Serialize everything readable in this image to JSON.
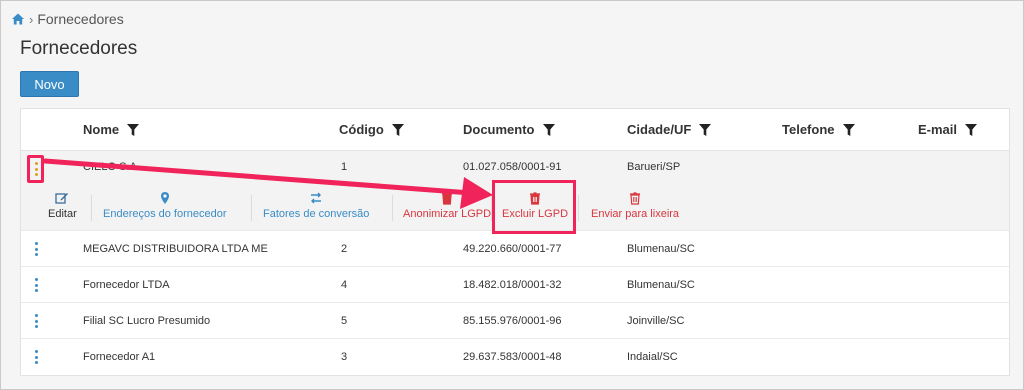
{
  "breadcrumb": {
    "current": "Fornecedores"
  },
  "page": {
    "title": "Fornecedores"
  },
  "toolbar": {
    "new_label": "Novo"
  },
  "table": {
    "columns": [
      "Nome",
      "Código",
      "Documento",
      "Cidade/UF",
      "Telefone",
      "E-mail"
    ],
    "rows": [
      {
        "nome": "CIELO S.A",
        "codigo": "1",
        "documento": "01.027.058/0001-91",
        "cidade": "Barueri/SP",
        "telefone": "",
        "email": ""
      },
      {
        "nome": "MEGAVC DISTRIBUIDORA LTDA ME",
        "codigo": "2",
        "documento": "49.220.660/0001-77",
        "cidade": "Blumenau/SC",
        "telefone": "",
        "email": ""
      },
      {
        "nome": "Fornecedor LTDA",
        "codigo": "4",
        "documento": "18.482.018/0001-32",
        "cidade": "Blumenau/SC",
        "telefone": "",
        "email": ""
      },
      {
        "nome": "Filial SC Lucro Presumido",
        "codigo": "5",
        "documento": "85.155.976/0001-96",
        "cidade": "Joinville/SC",
        "telefone": "",
        "email": ""
      },
      {
        "nome": "Fornecedor A1",
        "codigo": "3",
        "documento": "29.637.583/0001-48",
        "cidade": "Indaial/SC",
        "telefone": "",
        "email": ""
      }
    ]
  },
  "row_actions": {
    "editar": "Editar",
    "enderecos": "Endereços do fornecedor",
    "fatores": "Fatores de conversão",
    "anonimizar": "Anonimizar LGPD",
    "excluir": "Excluir LGPD",
    "lixeira": "Enviar para lixeira"
  },
  "icons": {
    "home": "home-icon",
    "filter": "filter-icon",
    "kebab": "vertical-dots-icon",
    "edit": "pencil-square-icon",
    "location": "map-pin-icon",
    "conversion": "swap-arrows-icon",
    "trash": "trash-icon"
  },
  "colors": {
    "primary": "#3a8cc7",
    "danger": "#d9363e",
    "highlight": "#f0245a",
    "active_kebab": "#e69b29"
  }
}
